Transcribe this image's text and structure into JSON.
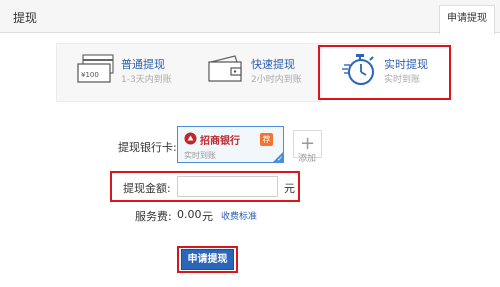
{
  "header": {
    "title": "提现",
    "tab_label": "申请提现"
  },
  "methods": [
    {
      "title": "普通提现",
      "subtitle": "1-3天内到账",
      "icon": "card-icon",
      "card_text": "¥100"
    },
    {
      "title": "快速提现",
      "subtitle": "2小时内到账",
      "icon": "wallet-icon"
    },
    {
      "title": "实时提现",
      "subtitle": "实时到账",
      "icon": "stopwatch-icon"
    }
  ],
  "selected_method": "实时提现",
  "bank_card": {
    "label": "提现银行卡:",
    "bank_name": "招商银行",
    "subtitle": "实时到账",
    "tag": "荐",
    "add_label": "添加"
  },
  "amount": {
    "label": "提现金额:",
    "value": "",
    "placeholder": "",
    "unit": "元"
  },
  "fee": {
    "label": "服务费:",
    "value": "0.00",
    "unit": "元",
    "link": "收费标准"
  },
  "submit_label": "申请提现",
  "colors": {
    "accent": "#2c66b8",
    "highlight": "#d8171c",
    "bank_red": "#c0272d"
  }
}
